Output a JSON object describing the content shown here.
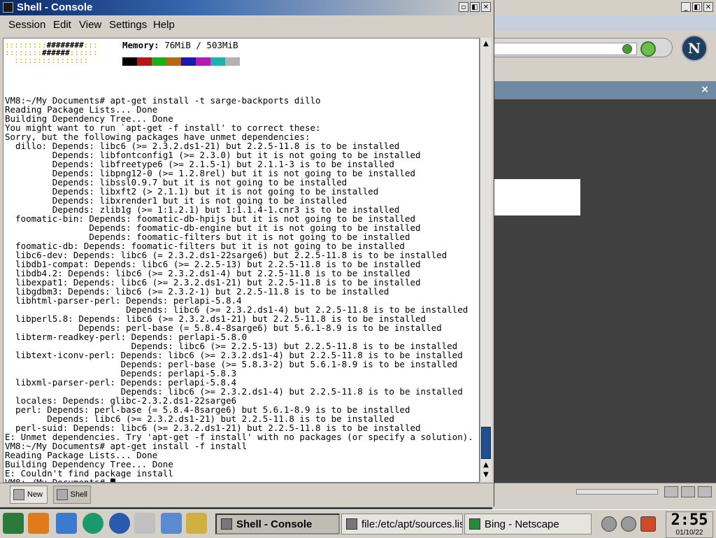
{
  "netscape": {
    "tab_close": "×",
    "logo_letter": "N"
  },
  "konsole": {
    "title": "Shell - Console",
    "window_buttons": [
      "▫",
      "◧",
      "✕"
    ],
    "menu": [
      "Session",
      "Edit",
      "View",
      "Settings",
      "Help"
    ],
    "memory_label": "Memory:",
    "memory_value": " 76MiB / 503MiB",
    "palette": [
      "#000000",
      "#b21818",
      "#18b218",
      "#b26818",
      "#1818b2",
      "#b218b2",
      "#18b2b2",
      "#b2b2b2"
    ],
    "terminal_lines": [
      "",
      "VM8:~/My Documents# apt-get install -t sarge-backports dillo",
      "Reading Package Lists... Done",
      "Building Dependency Tree... Done",
      "You might want to run `apt-get -f install' to correct these:",
      "Sorry, but the following packages have unmet dependencies:",
      "  dillo: Depends: libc6 (>= 2.3.2.ds1-21) but 2.2.5-11.8 is to be installed",
      "         Depends: libfontconfig1 (>= 2.3.0) but it is not going to be installed",
      "         Depends: libfreetype6 (>= 2.1.5-1) but 2.1.1-3 is to be installed",
      "         Depends: libpng12-0 (>= 1.2.8rel) but it is not going to be installed",
      "         Depends: libssl0.9.7 but it is not going to be installed",
      "         Depends: libxft2 (> 2.1.1) but it is not going to be installed",
      "         Depends: libxrender1 but it is not going to be installed",
      "         Depends: zlib1g (>= 1:1.2.1) but 1:1.1.4-1.cnr3 is to be installed",
      "  foomatic-bin: Depends: foomatic-db-hpijs but it is not going to be installed",
      "                Depends: foomatic-db-engine but it is not going to be installed",
      "                Depends: foomatic-filters but it is not going to be installed",
      "  foomatic-db: Depends: foomatic-filters but it is not going to be installed",
      "  libc6-dev: Depends: libc6 (= 2.3.2.ds1-22sarge6) but 2.2.5-11.8 is to be installed",
      "  libdb1-compat: Depends: libc6 (>= 2.2.5-13) but 2.2.5-11.8 is to be installed",
      "  libdb4.2: Depends: libc6 (>= 2.3.2.ds1-4) but 2.2.5-11.8 is to be installed",
      "  libexpat1: Depends: libc6 (>= 2.3.2.ds1-21) but 2.2.5-11.8 is to be installed",
      "  libgdbm3: Depends: libc6 (>= 2.3.2-1) but 2.2.5-11.8 is to be installed",
      "  libhtml-parser-perl: Depends: perlapi-5.8.4",
      "                       Depends: libc6 (>= 2.3.2.ds1-4) but 2.2.5-11.8 is to be installed",
      "  libperl5.8: Depends: libc6 (>= 2.3.2.ds1-21) but 2.2.5-11.8 is to be installed",
      "              Depends: perl-base (= 5.8.4-8sarge6) but 5.6.1-8.9 is to be installed",
      "  libterm-readkey-perl: Depends: perlapi-5.8.0",
      "                        Depends: libc6 (>= 2.2.5-13) but 2.2.5-11.8 is to be installed",
      "  libtext-iconv-perl: Depends: libc6 (>= 2.3.2.ds1-4) but 2.2.5-11.8 is to be installed",
      "                      Depends: perl-base (>= 5.8.3-2) but 5.6.1-8.9 is to be installed",
      "                      Depends: perlapi-5.8.3",
      "  libxml-parser-perl: Depends: perlapi-5.8.4",
      "                      Depends: libc6 (>= 2.3.2.ds1-4) but 2.2.5-11.8 is to be installed",
      "  locales: Depends: glibc-2.3.2.ds1-22sarge6",
      "  perl: Depends: perl-base (= 5.8.4-8sarge6) but 5.6.1-8.9 is to be installed",
      "        Depends: libc6 (>= 2.3.2.ds1-21) but 2.2.5-11.8 is to be installed",
      "  perl-suid: Depends: libc6 (>= 2.3.2.ds1-21) but 2.2.5-11.8 is to be installed",
      "E: Unmet dependencies. Try 'apt-get -f install' with no packages (or specify a solution).",
      "VM8:~/My Documents# apt-get install -f install",
      "Reading Package Lists... Done",
      "Building Dependency Tree... Done",
      "E: Couldn't find package install"
    ],
    "prompt": "VM8:~/My Documents# ",
    "scroll_up": "▲",
    "scroll_down": "▼",
    "tabs": {
      "new": "New",
      "shell": "Shell"
    }
  },
  "taskbar": {
    "tasks": {
      "console": "Shell - Console",
      "sources": "file:/etc/apt/sources.list",
      "netscape": "Bing - Netscape"
    },
    "clock_time": "2:55",
    "clock_date": "01/10/22"
  }
}
